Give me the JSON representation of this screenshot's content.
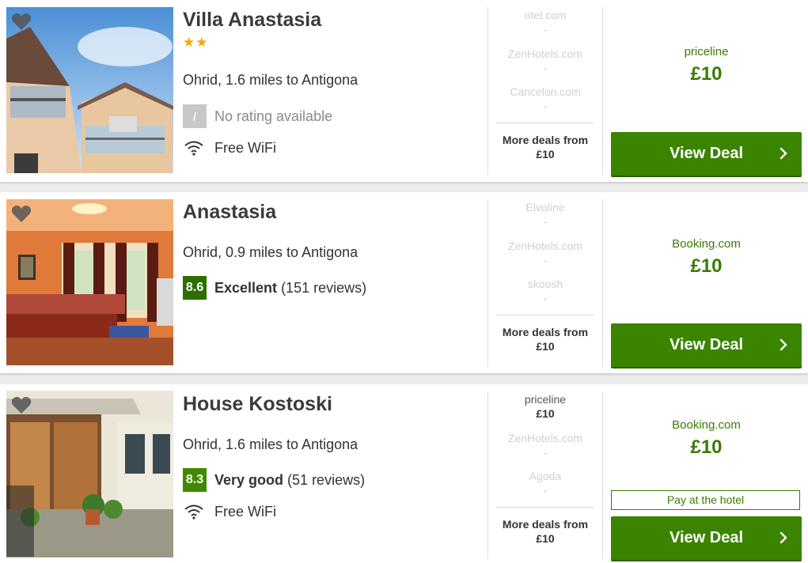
{
  "hotels": [
    {
      "name": "Villa Anastasia",
      "stars": "★★",
      "location": "Ohrid, 1.6 miles to Antigona",
      "score": "/",
      "rating_label": "No rating available",
      "rating_reviews": "",
      "amenity": "Free WiFi",
      "deals": [
        {
          "provider": "otel.com",
          "price": "-"
        },
        {
          "provider": "ZenHotels.com",
          "price": "-"
        },
        {
          "provider": "Cancelon.com",
          "price": "-"
        }
      ],
      "more_deals": "More deals from",
      "more_deals_price": "£10",
      "best_provider": "priceline",
      "best_price": "£10",
      "cta": "View Deal"
    },
    {
      "name": "Anastasia",
      "location": "Ohrid, 0.9 miles to Antigona",
      "score": "8.6",
      "rating_label": "Excellent",
      "rating_reviews": "(151 reviews)",
      "deals": [
        {
          "provider": "Elvoline",
          "price": "-"
        },
        {
          "provider": "ZenHotels.com",
          "price": "-"
        },
        {
          "provider": "skoosh",
          "price": "-"
        }
      ],
      "more_deals": "More deals from",
      "more_deals_price": "£10",
      "best_provider": "Booking.com",
      "best_price": "£10",
      "cta": "View Deal"
    },
    {
      "name": "House Kostoski",
      "location": "Ohrid, 1.6 miles to Antigona",
      "score": "8.3",
      "rating_label": "Very good",
      "rating_reviews": "(51 reviews)",
      "amenity": "Free WiFi",
      "deals": [
        {
          "provider": "priceline",
          "price": "£10"
        },
        {
          "provider": "ZenHotels.com",
          "price": "-"
        },
        {
          "provider": "Agoda",
          "price": "-"
        }
      ],
      "more_deals": "More deals from",
      "more_deals_price": "£10",
      "best_provider": "Booking.com",
      "best_price": "£10",
      "pay_at_hotel": "Pay at the hotel",
      "cta": "View Deal"
    }
  ],
  "colors": {
    "accent_green": "#3a8400",
    "star_gold": "#f1a900",
    "score_excellent": "#2c6e00",
    "score_good": "#3f8a00"
  }
}
